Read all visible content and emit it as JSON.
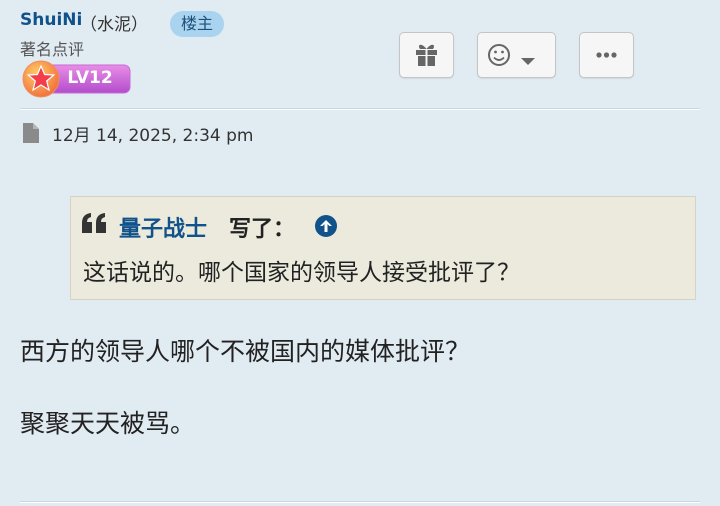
{
  "post": {
    "author": "ShuiNi",
    "nickname": "（水泥）",
    "op_badge": "楼主",
    "rank": "著名点评",
    "level": "LV12",
    "date": "12月 14, 2025, 2:34 pm"
  },
  "actions": {
    "gift_icon": "gift-icon",
    "react_icon": "smiley-icon",
    "more_icon": "ellipsis-icon"
  },
  "quote": {
    "author": "量子战士",
    "wrote": "写了：",
    "text": "这话说的。哪个国家的领导人接受批评了？"
  },
  "body": {
    "lines": [
      "西方的领导人哪个不被国内的媒体批评？",
      "聚聚天天被骂。"
    ]
  },
  "colors": {
    "background": "#e1ebf2",
    "link": "#105289",
    "quote_bg": "#ebeadd",
    "badge_bg": "#a9d3ee"
  }
}
